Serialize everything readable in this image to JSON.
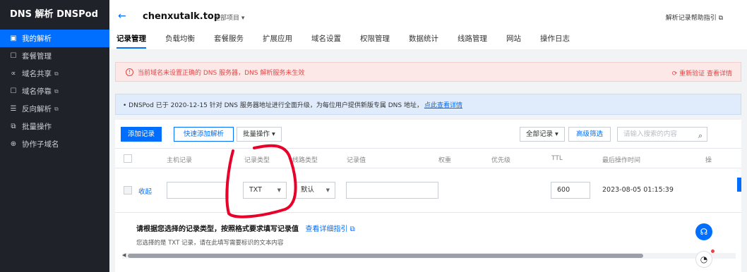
{
  "sidebar": {
    "brand": "DNS 解析 DNSPod",
    "items": [
      {
        "label": "我的解析",
        "icon": "dns-icon",
        "glyph": "▣",
        "active": true,
        "external": false
      },
      {
        "label": "套餐管理",
        "icon": "package-icon",
        "glyph": "☐",
        "active": false,
        "external": false
      },
      {
        "label": "域名共享",
        "icon": "share-icon",
        "glyph": "∝",
        "active": false,
        "external": true
      },
      {
        "label": "域名停靠",
        "icon": "parking-icon",
        "glyph": "☐",
        "active": false,
        "external": true
      },
      {
        "label": "反向解析",
        "icon": "reverse-icon",
        "glyph": "☰",
        "active": false,
        "external": true
      },
      {
        "label": "批量操作",
        "icon": "batch-icon",
        "glyph": "⧉",
        "active": false,
        "external": false
      },
      {
        "label": "协作子域名",
        "icon": "globe-icon",
        "glyph": "⊕",
        "active": false,
        "external": false
      }
    ],
    "external_glyph": "⧉"
  },
  "header": {
    "domain": "chenxutalk.top",
    "project": "全部项目 ▾",
    "help_link": "解析记录帮助指引 ⧉"
  },
  "tabs": [
    "记录管理",
    "负载均衡",
    "套餐服务",
    "扩展应用",
    "域名设置",
    "权限管理",
    "数据统计",
    "线路管理",
    "网站",
    "操作日志"
  ],
  "alert": {
    "text": "当前域名未设置正确的 DNS 服务器，DNS 解析服务未生效",
    "actions": "重新验证  查看详情"
  },
  "notice": {
    "text": "• DNSPod 已于 2020-12-15 针对 DNS 服务器地址进行全面升级，为每位用户提供新版专属 DNS 地址，",
    "link": "点此查看详情"
  },
  "toolbar": {
    "add": "添加记录",
    "quick_add": "快速添加解析",
    "batch": "批量操作 ▾",
    "all_records": "全部记录 ▾",
    "advanced_filter": "高级筛选",
    "search_placeholder": "请输入搜索的内容"
  },
  "table": {
    "headers": [
      "主机记录",
      "记录类型",
      "线路类型",
      "记录值",
      "权重",
      "优先级",
      "TTL",
      "最后操作时间",
      "操"
    ],
    "row": {
      "collapse": "收起",
      "host": "",
      "type": "TXT",
      "line": "默认",
      "value": "",
      "ttl": "600",
      "time": "2023-08-05 01:15:39"
    }
  },
  "guide": {
    "title": "请根据您选择的记录类型，按照格式要求填写记录值",
    "link": "查看详细指引 ⧉",
    "sub": "您选择的是 TXT 记录，请在此填写需要标识的文本内容"
  },
  "colors": {
    "accent": "#006eff",
    "alert": "#e54545",
    "annotation": "#e8002a"
  }
}
